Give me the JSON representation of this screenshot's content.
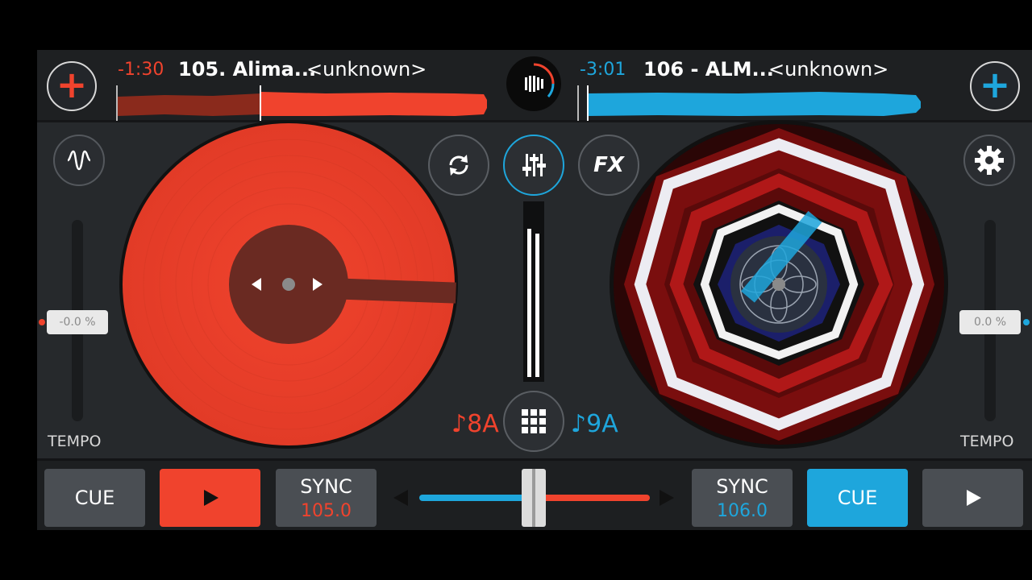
{
  "colors": {
    "deck_a": "#f0432d",
    "deck_b": "#1ea6dc",
    "background": "#26292c"
  },
  "deck_a": {
    "add_icon": "plus-icon",
    "time_remaining": "-1:30",
    "title": "105. Alima...",
    "artist": "<unknown>",
    "tempo_value": "-0.0 %",
    "tempo_label": "TEMPO",
    "key": "♪8A",
    "cue_label": "CUE",
    "play_icon": "play-icon",
    "sync_label": "SYNC",
    "bpm": "105.0",
    "playback_progress": 0.39
  },
  "deck_b": {
    "add_icon": "plus-icon",
    "time_remaining": "-3:01",
    "title": "106 - ALM...",
    "artist": "<unknown>",
    "tempo_value": "0.0 %",
    "tempo_label": "TEMPO",
    "key": "♪9A",
    "cue_label": "CUE",
    "play_icon": "play-icon",
    "sync_label": "SYNC",
    "bpm": "106.0",
    "playback_progress": 0.02
  },
  "center": {
    "logo_icon": "app-logo-icon",
    "loop_icon": "loop-icon",
    "mixer_icon": "mixer-icon",
    "fx_label": "FX",
    "grid_icon": "grid-icon",
    "waveform_icon": "waveform-icon",
    "settings_icon": "gear-icon",
    "crossfader_position": 0.5
  }
}
